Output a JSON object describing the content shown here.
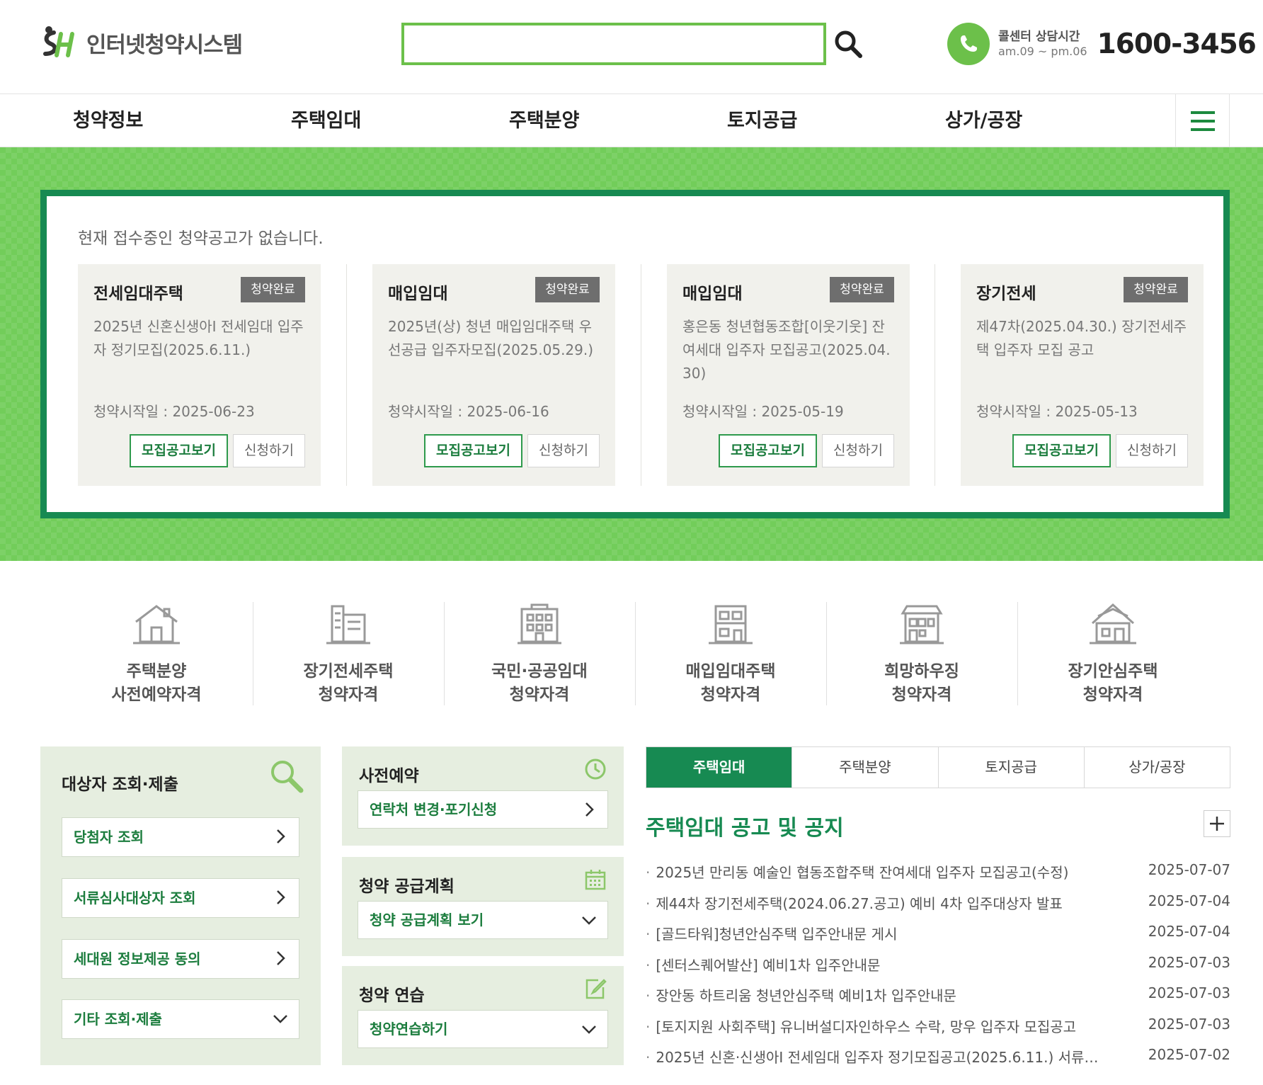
{
  "header": {
    "logo_text": "인터넷청약시스템",
    "search_value": "",
    "callcenter_label": "콜센터 상담시간",
    "callcenter_hours": "am.09 ~ pm.06",
    "callcenter_number": "1600-3456"
  },
  "gnb": [
    "청약정보",
    "주택임대",
    "주택분양",
    "토지공급",
    "상가/공장"
  ],
  "hero": {
    "message": "현재 접수중인 청약공고가 없습니다.",
    "cards": [
      {
        "category": "전세임대주택",
        "badge": "청약완료",
        "title": "2025년 신혼신생아Ⅰ 전세임대 입주자 정기모집(2025.6.11.)",
        "date": "청약시작일 : 2025-06-23",
        "btn_notice": "모집공고보기",
        "btn_apply": "신청하기"
      },
      {
        "category": "매입임대",
        "badge": "청약완료",
        "title": "2025년(상) 청년 매입임대주택 우선공급 입주자모집(2025.05.29.)",
        "date": "청약시작일 : 2025-06-16",
        "btn_notice": "모집공고보기",
        "btn_apply": "신청하기"
      },
      {
        "category": "매입임대",
        "badge": "청약완료",
        "title": "홍은동 청년협동조합[이웃기웃] 잔여세대 입주자 모집공고(2025.04.30)",
        "date": "청약시작일 : 2025-05-19",
        "btn_notice": "모집공고보기",
        "btn_apply": "신청하기"
      },
      {
        "category": "장기전세",
        "badge": "청약완료",
        "title": "제47차(2025.04.30.) 장기전세주택 입주자 모집 공고",
        "date": "청약시작일 : 2025-05-13",
        "btn_notice": "모집공고보기",
        "btn_apply": "신청하기"
      }
    ]
  },
  "qualifications": [
    {
      "line1": "주택분양",
      "line2": "사전예약자격",
      "icon": "house-icon"
    },
    {
      "line1": "장기전세주택",
      "line2": "청약자격",
      "icon": "apartment-icon"
    },
    {
      "line1": "국민·공공임대",
      "line2": "청약자격",
      "icon": "building-icon"
    },
    {
      "line1": "매입임대주택",
      "line2": "청약자격",
      "icon": "villa-icon"
    },
    {
      "line1": "희망하우징",
      "line2": "청약자격",
      "icon": "dormitory-icon"
    },
    {
      "line1": "장기안심주택",
      "line2": "청약자격",
      "icon": "home-icon"
    }
  ],
  "target_panel": {
    "title": "대상자 조회·제출",
    "links": [
      "당첨자 조회",
      "서류심사대상자 조회",
      "세대원 정보제공 동의",
      "기타 조회·제출"
    ]
  },
  "reserve_panel": {
    "title": "사전예약",
    "link": "연락처 변경·포기신청"
  },
  "plan_panel": {
    "title": "청약 공급계획",
    "link": "청약 공급계획 보기"
  },
  "practice_panel": {
    "title": "청약 연습",
    "link": "청약연습하기"
  },
  "tabs": [
    "주택임대",
    "주택분양",
    "토지공급",
    "상가/공장"
  ],
  "notice_heading": "주택임대 공고 및 공지",
  "notices": [
    {
      "title": "2025년 만리동 예술인 협동조합주택 잔여세대 입주자 모집공고(수정)",
      "date": "2025-07-07"
    },
    {
      "title": "제44차 장기전세주택(2024.06.27.공고) 예비 4차 입주대상자 발표",
      "date": "2025-07-04"
    },
    {
      "title": "[골드타워]청년안심주택 입주안내문 게시",
      "date": "2025-07-04"
    },
    {
      "title": "[센터스퀘어발산] 예비1차 입주안내문",
      "date": "2025-07-03"
    },
    {
      "title": "장안동 하트리움 청년안심주택 예비1차 입주안내문",
      "date": "2025-07-03"
    },
    {
      "title": "[토지지원 사회주택] 유니버설디자인하우스 수락, 망우 입주자 모집공고",
      "date": "2025-07-03"
    },
    {
      "title": "2025년 신혼·신생아Ⅰ 전세임대 입주자 정기모집공고(2025.6.11.) 서류…",
      "date": "2025-07-02"
    }
  ],
  "colors": {
    "brand_green": "#178a52",
    "light_green": "#6cc04a",
    "panel_bg": "#e6eee0"
  }
}
